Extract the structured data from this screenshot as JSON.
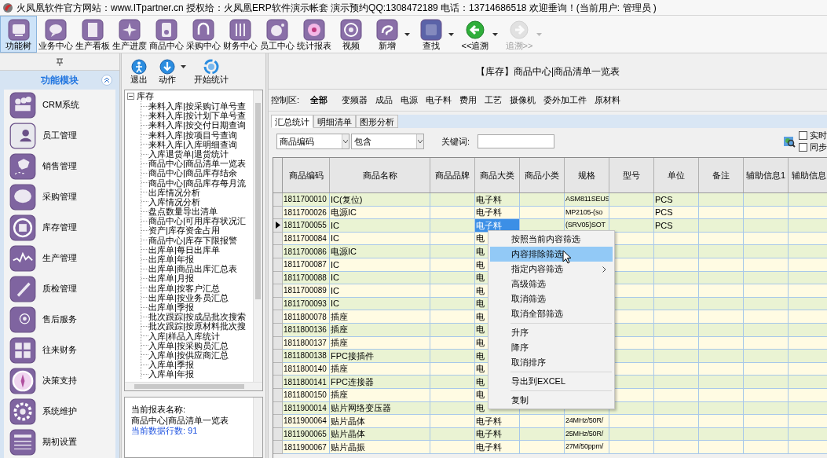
{
  "window": {
    "title": "火凤凰软件官方网站：www.ITpartner.cn  授权给：火凤凰ERP软件演示帐套 演示预约QQ:1308472189 电话：13714686518 欢迎垂询！(当前用户: 管理员 )"
  },
  "toolbar": [
    {
      "label": "功能树",
      "selected": true,
      "dropdown": false,
      "disabled": false
    },
    {
      "label": "业务中心",
      "selected": false,
      "dropdown": false,
      "disabled": false
    },
    {
      "label": "生产看板",
      "selected": false,
      "dropdown": false,
      "disabled": false
    },
    {
      "label": "生产进度",
      "selected": false,
      "dropdown": false,
      "disabled": false
    },
    {
      "label": "商品中心",
      "selected": false,
      "dropdown": false,
      "disabled": false
    },
    {
      "label": "采购中心",
      "selected": false,
      "dropdown": false,
      "disabled": false
    },
    {
      "label": "财务中心",
      "selected": false,
      "dropdown": false,
      "disabled": false
    },
    {
      "label": "员工中心",
      "selected": false,
      "dropdown": false,
      "disabled": false
    },
    {
      "label": "统计报表",
      "selected": false,
      "dropdown": false,
      "disabled": false
    },
    {
      "label": "视频",
      "selected": false,
      "dropdown": false,
      "disabled": false
    },
    {
      "label": "新增",
      "selected": false,
      "dropdown": true,
      "disabled": false
    },
    {
      "label": "查找",
      "selected": false,
      "dropdown": true,
      "disabled": false
    },
    {
      "label": "<<追溯",
      "selected": false,
      "dropdown": true,
      "disabled": false
    },
    {
      "label": "追溯>>",
      "selected": false,
      "dropdown": true,
      "disabled": true
    }
  ],
  "sidebar": {
    "title": "功能模块",
    "items": [
      {
        "label": "CRM系统"
      },
      {
        "label": "员工管理"
      },
      {
        "label": "销售管理"
      },
      {
        "label": "采购管理"
      },
      {
        "label": "库存管理"
      },
      {
        "label": "生产管理"
      },
      {
        "label": "质检管理"
      },
      {
        "label": "售后服务"
      },
      {
        "label": "往来财务"
      },
      {
        "label": "决策支持"
      },
      {
        "label": "系统维护"
      },
      {
        "label": "期初设置"
      }
    ]
  },
  "report_panel": {
    "actions": [
      {
        "label": "退出",
        "dropdown": false
      },
      {
        "label": "动作",
        "dropdown": true
      },
      {
        "label": "开始统计",
        "dropdown": false
      }
    ],
    "tree": {
      "label": "库存",
      "expanded": true,
      "children": [
        {
          "label": "来料入库|按采购订单号查"
        },
        {
          "label": "来料入库|按计划下单号查"
        },
        {
          "label": "来料入库|按交付日期查询"
        },
        {
          "label": "来料入库|按项目号查询"
        },
        {
          "label": "来料入库|入库明细查询"
        },
        {
          "label": "入库退货单|退货统计"
        },
        {
          "label": "商品中心|商品清单一览表"
        },
        {
          "label": "商品中心|商品库存结余"
        },
        {
          "label": "商品中心|商品库存每月流"
        },
        {
          "label": "出库情况分析"
        },
        {
          "label": "入库情况分析"
        },
        {
          "label": "盘点数量导出清单"
        },
        {
          "label": "商品中心|可用库存状况汇"
        },
        {
          "label": "资产|库存资金占用"
        },
        {
          "label": "商品中心|库存下限报警"
        },
        {
          "label": "出库单|每日出库单"
        },
        {
          "label": "出库单|年报"
        },
        {
          "label": "出库单|商品出库汇总表"
        },
        {
          "label": "出库单|月报"
        },
        {
          "label": "出库单|按客户汇总"
        },
        {
          "label": "出库单|按业务员汇总"
        },
        {
          "label": "出库单|季报"
        },
        {
          "label": "批次跟踪|按成品批次搜索"
        },
        {
          "label": "批次跟踪|按原材料批次搜"
        },
        {
          "label": "入库|样品入库统计"
        },
        {
          "label": "入库单|按采购员汇总"
        },
        {
          "label": "入库单|按供应商汇总"
        },
        {
          "label": "入库单|季报"
        },
        {
          "label": "入库单|年报"
        }
      ]
    },
    "info": {
      "name_label": "当前报表名称:",
      "name_value": "商品中心|商品清单一览表",
      "row_count": "当前数据行数: 91"
    }
  },
  "main": {
    "title": "【库存】商品中心|商品清单一览表",
    "control_label": "控制区:",
    "filters": [
      {
        "label": "全部",
        "selected": true
      },
      {
        "label": "变频器",
        "selected": false
      },
      {
        "label": "成品",
        "selected": false
      },
      {
        "label": "电源",
        "selected": false
      },
      {
        "label": "电子料",
        "selected": false
      },
      {
        "label": "费用",
        "selected": false
      },
      {
        "label": "工艺",
        "selected": false
      },
      {
        "label": "摄像机",
        "selected": false
      },
      {
        "label": "委外加工件",
        "selected": false
      },
      {
        "label": "原材料",
        "selected": false
      }
    ],
    "tabs": [
      {
        "label": "汇总统计",
        "selected": true
      },
      {
        "label": "明细清单",
        "selected": false
      },
      {
        "label": "图形分析",
        "selected": false
      }
    ],
    "field_select": "商品编码",
    "operator_select": "包含",
    "keyword_label": "关键词:",
    "options": [
      {
        "label": "实时",
        "checked": false
      },
      {
        "label": "同步",
        "checked": false
      }
    ],
    "table": {
      "columns": [
        "商品编码",
        "商品名称",
        "商品品牌",
        "商品大类",
        "商品小类",
        "规格",
        "型号",
        "单位",
        "备注",
        "辅助信息1",
        "辅助信息"
      ],
      "rows": [
        {
          "code": "1811700010",
          "name": "IC(复位)",
          "category": "电子料",
          "spec": "ASM811SEUS",
          "unit": "PCS",
          "selected": false
        },
        {
          "code": "1811700026",
          "name": "电源IC",
          "category": "电子料",
          "spec": "MP2105-(so",
          "unit": "PCS",
          "selected": false
        },
        {
          "code": "1811700055",
          "name": "IC",
          "category": "电子料",
          "spec": "(SRV05)SOT",
          "unit": "PCS",
          "selected": true
        },
        {
          "code": "1811700084",
          "name": "IC",
          "category": "电",
          "selected": false
        },
        {
          "code": "1811700086",
          "name": "电源IC",
          "category": "电",
          "selected": false
        },
        {
          "code": "1811700087",
          "name": "IC",
          "category": "电",
          "selected": false
        },
        {
          "code": "1811700088",
          "name": "IC",
          "category": "电",
          "selected": false
        },
        {
          "code": "1811700089",
          "name": "IC",
          "category": "电",
          "selected": false
        },
        {
          "code": "1811700093",
          "name": "IC",
          "category": "电",
          "selected": false
        },
        {
          "code": "1811800078",
          "name": "插座",
          "category": "电",
          "selected": false
        },
        {
          "code": "1811800136",
          "name": "插座",
          "category": "电",
          "selected": false
        },
        {
          "code": "1811800137",
          "name": "插座",
          "category": "电",
          "selected": false
        },
        {
          "code": "1811800138",
          "name": "FPC接插件",
          "category": "电",
          "selected": false
        },
        {
          "code": "1811800140",
          "name": "插座",
          "category": "电",
          "selected": false
        },
        {
          "code": "1811800141",
          "name": "FPC连接器",
          "category": "电",
          "selected": false
        },
        {
          "code": "1811800150",
          "name": "插座",
          "category": "电",
          "selected": false
        },
        {
          "code": "1811900014",
          "name": "贴片网络变压器",
          "category": "电",
          "selected": false
        },
        {
          "code": "1811900064",
          "name": "贴片晶体",
          "category": "电子料",
          "spec": "24MHz/50R/",
          "selected": false
        },
        {
          "code": "1811900065",
          "name": "贴片晶体",
          "category": "电子料",
          "spec": "25MHz/50R/",
          "selected": false
        },
        {
          "code": "1811900067",
          "name": "贴片晶振",
          "category": "电子料",
          "spec": "27M/50ppm/",
          "selected": false
        }
      ]
    }
  },
  "context_menu": [
    {
      "kind": "item",
      "label": "按照当前内容筛选",
      "selected": false
    },
    {
      "kind": "item",
      "label": "内容排除筛选",
      "selected": true
    },
    {
      "kind": "item",
      "label": "指定内容筛选",
      "selected": false,
      "submenu": true
    },
    {
      "kind": "item",
      "label": "高级筛选",
      "selected": false
    },
    {
      "kind": "item",
      "label": "取消筛选",
      "selected": false
    },
    {
      "kind": "item",
      "label": "取消全部筛选",
      "selected": false
    },
    {
      "kind": "separator"
    },
    {
      "kind": "item",
      "label": "升序",
      "selected": false
    },
    {
      "kind": "item",
      "label": "降序",
      "selected": false
    },
    {
      "kind": "item",
      "label": "取消排序",
      "selected": false
    },
    {
      "kind": "separator"
    },
    {
      "kind": "item",
      "label": "导出到EXCEL",
      "selected": false
    },
    {
      "kind": "separator"
    },
    {
      "kind": "item",
      "label": "复制",
      "selected": false
    }
  ]
}
